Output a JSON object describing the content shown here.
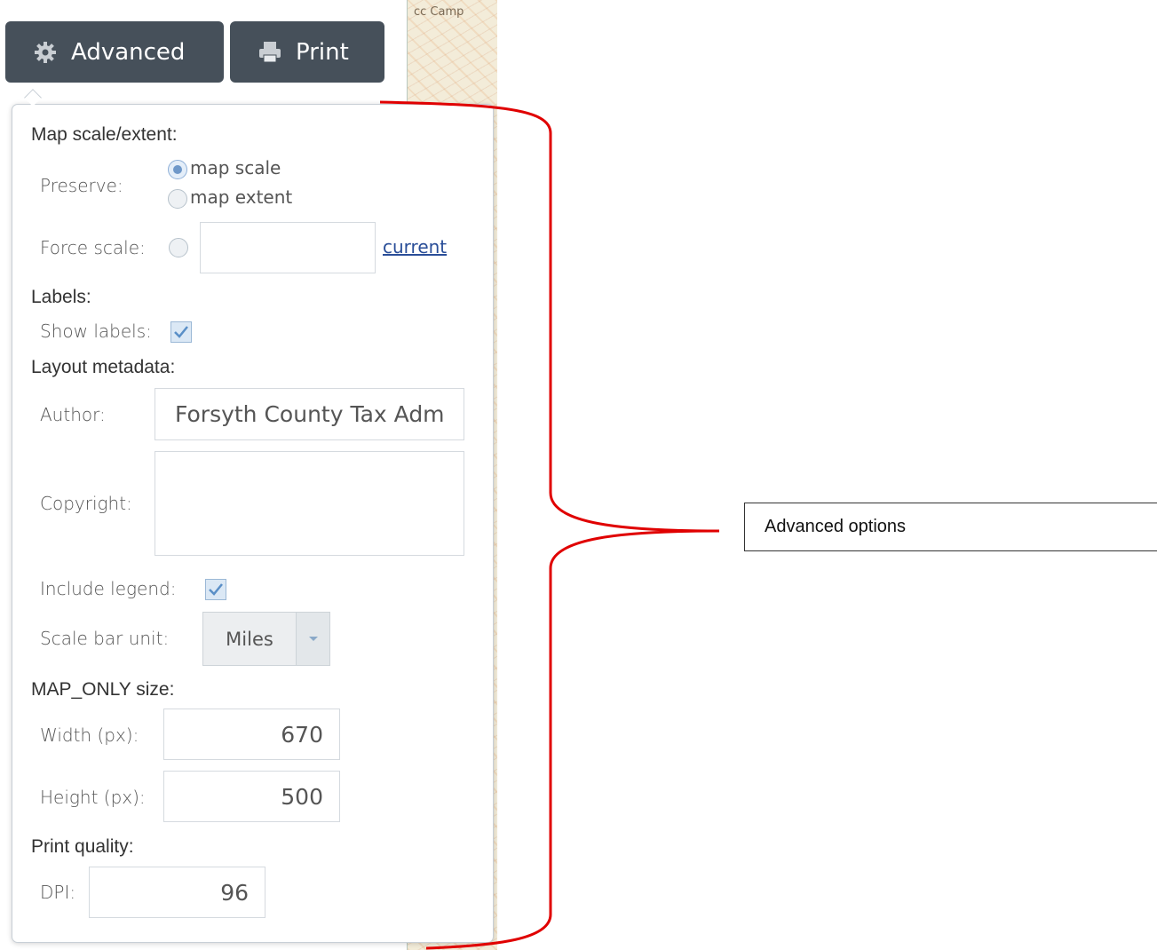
{
  "map": {
    "corner_label": "cc Camp"
  },
  "toolbar": {
    "advanced_label": "Advanced",
    "print_label": "Print"
  },
  "advanced_panel": {
    "map_scale_title": "Map scale/extent:",
    "preserve_label": "Preserve:",
    "preserve_options": [
      {
        "label": "map scale",
        "selected": true
      },
      {
        "label": "map extent",
        "selected": false
      }
    ],
    "force_scale_label": "Force scale:",
    "force_scale_value": "",
    "current_link": "current",
    "labels_title": "Labels:",
    "show_labels_label": "Show labels:",
    "show_labels_checked": true,
    "layout_metadata_title": "Layout metadata:",
    "author_label": "Author:",
    "author_value": "Forsyth County Tax Adm",
    "copyright_label": "Copyright:",
    "copyright_value": "",
    "include_legend_label": "Include legend:",
    "include_legend_checked": true,
    "scale_bar_unit_label": "Scale bar unit:",
    "scale_bar_unit_value": "Miles",
    "map_only_title": "MAP_ONLY size:",
    "width_label": "Width (px):",
    "width_value": "670",
    "height_label": "Height (px):",
    "height_value": "500",
    "print_quality_title": "Print quality:",
    "dpi_label": "DPI:",
    "dpi_value": "96"
  },
  "annotation": {
    "callout_text": "Advanced options",
    "bracket_color": "#e00000"
  },
  "colors": {
    "button_bg": "#46505a",
    "link": "#2a4e98"
  }
}
